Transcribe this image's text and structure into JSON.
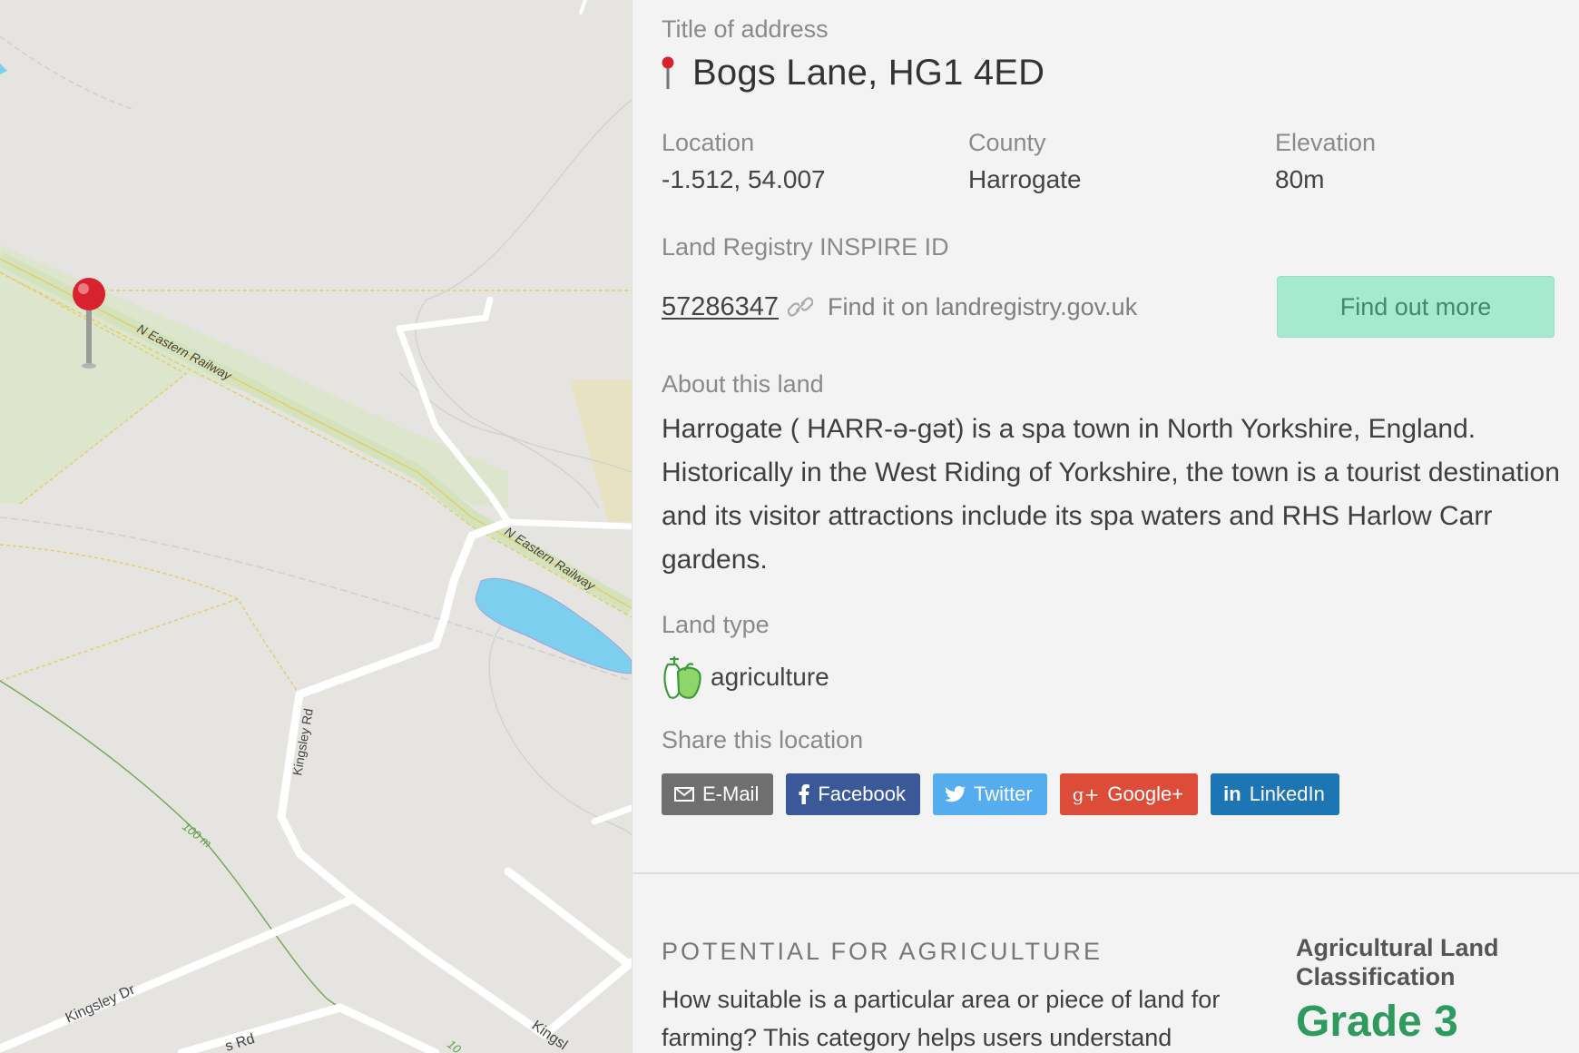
{
  "map": {
    "labels": {
      "railway_1": "N Eastern Railway",
      "railway_2": "N Eastern Railway",
      "road_kingsley_rd": "Kingsley Rd",
      "road_kingsley_dr": "Kingsley Dr",
      "road_partial_rd": "s Rd",
      "road_partial_kingsl": "Kingsl",
      "contour_100": "100 m",
      "contour_10_partial": "10"
    },
    "colors": {
      "water": "#7ccfef",
      "marker": "#d8232f",
      "railway": "#d4e2bd"
    }
  },
  "place": {
    "title_label": "Title of address",
    "title": "Bogs Lane, HG1 4ED",
    "location_label": "Location",
    "location": "-1.512, 54.007",
    "county_label": "County",
    "county": "Harrogate",
    "elevation_label": "Elevation",
    "elevation": "80m"
  },
  "registry": {
    "label": "Land Registry INSPIRE ID",
    "id": "57286347",
    "hint": "Find it on landregistry.gov.uk",
    "button": "Find out more"
  },
  "about": {
    "label": "About this land",
    "text": "Harrogate ( HARR-ə-gət) is a spa town in North Yorkshire, England. Historically in the West Riding of Yorkshire, the town is a tourist destination and its visitor attractions include its spa waters and RHS Harlow Carr gardens."
  },
  "land_type": {
    "label": "Land type",
    "value": "agriculture",
    "icon": "vegetable-icon"
  },
  "share": {
    "label": "Share this location",
    "email": "E-Mail",
    "facebook": "Facebook",
    "twitter": "Twitter",
    "googleplus": "Google+",
    "linkedin": "LinkedIn"
  },
  "agriculture": {
    "section_title": "POTENTIAL FOR AGRICULTURE",
    "description": "How suitable is a particular area or piece of land for farming? This category helps users understand",
    "classification_label": "Agricultural Land Classification",
    "grade": "Grade 3"
  }
}
